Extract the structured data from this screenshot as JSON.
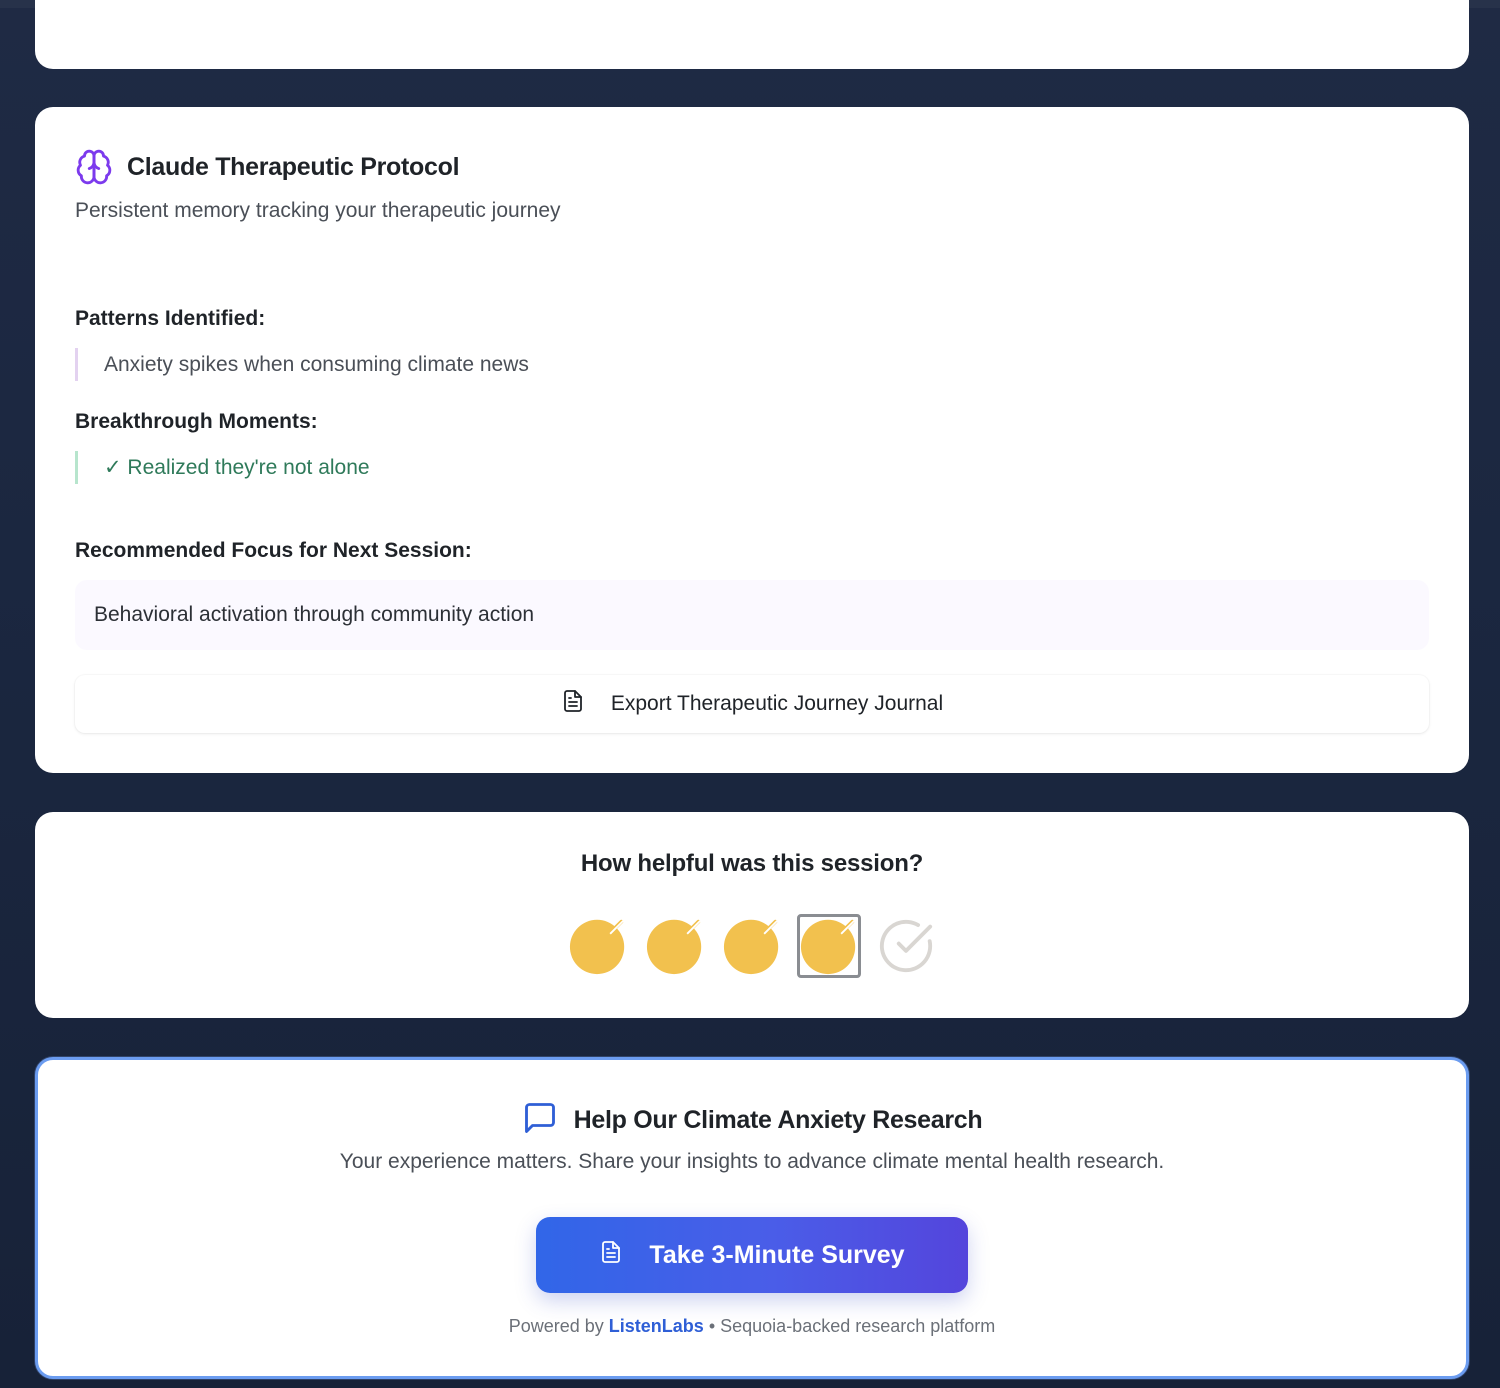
{
  "protocol": {
    "title": "Claude Therapeutic Protocol",
    "subtitle": "Persistent memory tracking your therapeutic journey",
    "patterns_label": "Patterns Identified:",
    "patterns": [
      "Anxiety spikes when consuming climate news"
    ],
    "breakthrough_label": "Breakthrough Moments:",
    "breakthroughs": [
      "✓ Realized they're not alone"
    ],
    "focus_label": "Recommended Focus for Next Session:",
    "focus": "Behavioral activation through community action",
    "export_label": "Export Therapeutic Journey Journal",
    "icon": "brain-icon",
    "accent_color": "#7c3aed"
  },
  "rating": {
    "title": "How helpful was this session?",
    "options_count": 5,
    "selected": 4,
    "filled_color": "#f2c14e",
    "empty_color": "#d9d6d2"
  },
  "survey": {
    "title": "Help Our Climate Anxiety Research",
    "subtitle": "Your experience matters. Share your insights to advance climate mental health research.",
    "button_label": "Take 3-Minute Survey",
    "powered_prefix": "Powered by",
    "powered_brand": "ListenLabs",
    "powered_suffix": "• Sequoia-backed research platform",
    "accent_color": "#2f5fd6"
  }
}
